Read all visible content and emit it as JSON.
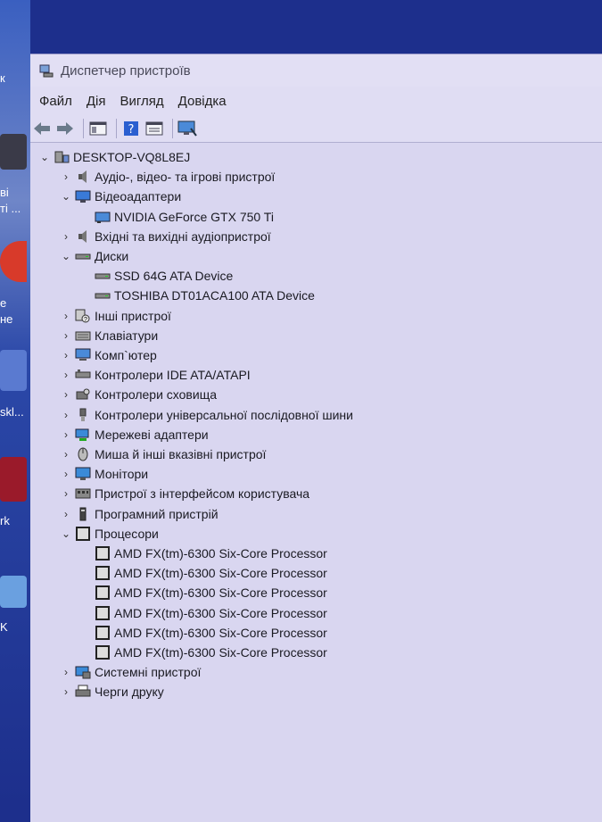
{
  "desktop": {
    "labels": [
      "к",
      "ві",
      "ті ...",
      "е",
      "не",
      "skl...",
      "rk",
      "K"
    ]
  },
  "window": {
    "title": "Диспетчер пристроїв",
    "menu": [
      "Файл",
      "Дія",
      "Вигляд",
      "Довідка"
    ]
  },
  "tree": {
    "root": "DESKTOP-VQ8L8EJ",
    "items": [
      {
        "label": "Аудіо-, відео- та ігрові пристрої",
        "icon": "speaker-icon",
        "expanded": false
      },
      {
        "label": "Відеоадаптери",
        "icon": "display-adapter-icon",
        "expanded": true,
        "children": [
          "NVIDIA GeForce GTX 750 Ti"
        ]
      },
      {
        "label": "Вхідні та вихідні аудіопристрої",
        "icon": "speaker-icon",
        "expanded": false
      },
      {
        "label": "Диски",
        "icon": "disk-drive-icon",
        "expanded": true,
        "children": [
          "SSD 64G ATA Device",
          "TOSHIBA DT01ACA100 ATA Device"
        ]
      },
      {
        "label": "Інші пристрої",
        "icon": "unknown-device-icon",
        "expanded": false
      },
      {
        "label": "Клавіатури",
        "icon": "keyboard-icon",
        "expanded": false
      },
      {
        "label": "Комп`ютер",
        "icon": "computer-icon",
        "expanded": false
      },
      {
        "label": "Контролери IDE ATA/ATAPI",
        "icon": "ide-controller-icon",
        "expanded": false
      },
      {
        "label": "Контролери сховища",
        "icon": "storage-controller-icon",
        "expanded": false
      },
      {
        "label": "Контролери універсальної послідовної шини",
        "icon": "usb-icon",
        "expanded": false
      },
      {
        "label": "Мережеві адаптери",
        "icon": "network-adapter-icon",
        "expanded": false
      },
      {
        "label": "Миша й інші вказівні пристрої",
        "icon": "mouse-icon",
        "expanded": false
      },
      {
        "label": "Монітори",
        "icon": "monitor-icon",
        "expanded": false
      },
      {
        "label": "Пристрої з інтерфейсом користувача",
        "icon": "hid-icon",
        "expanded": false
      },
      {
        "label": "Програмний пристрій",
        "icon": "software-device-icon",
        "expanded": false
      },
      {
        "label": "Процесори",
        "icon": "processor-icon",
        "expanded": true,
        "children": [
          "AMD FX(tm)-6300 Six-Core Processor",
          "AMD FX(tm)-6300 Six-Core Processor",
          "AMD FX(tm)-6300 Six-Core Processor",
          "AMD FX(tm)-6300 Six-Core Processor",
          "AMD FX(tm)-6300 Six-Core Processor",
          "AMD FX(tm)-6300 Six-Core Processor"
        ]
      },
      {
        "label": "Системні пристрої",
        "icon": "system-device-icon",
        "expanded": false
      },
      {
        "label": "Черги друку",
        "icon": "printer-icon",
        "expanded": false
      }
    ]
  },
  "colors": {
    "window_bg": "#d9d6f0",
    "desktop_bg": "#1d2f8c",
    "accent_blue": "#2b5fd0"
  }
}
